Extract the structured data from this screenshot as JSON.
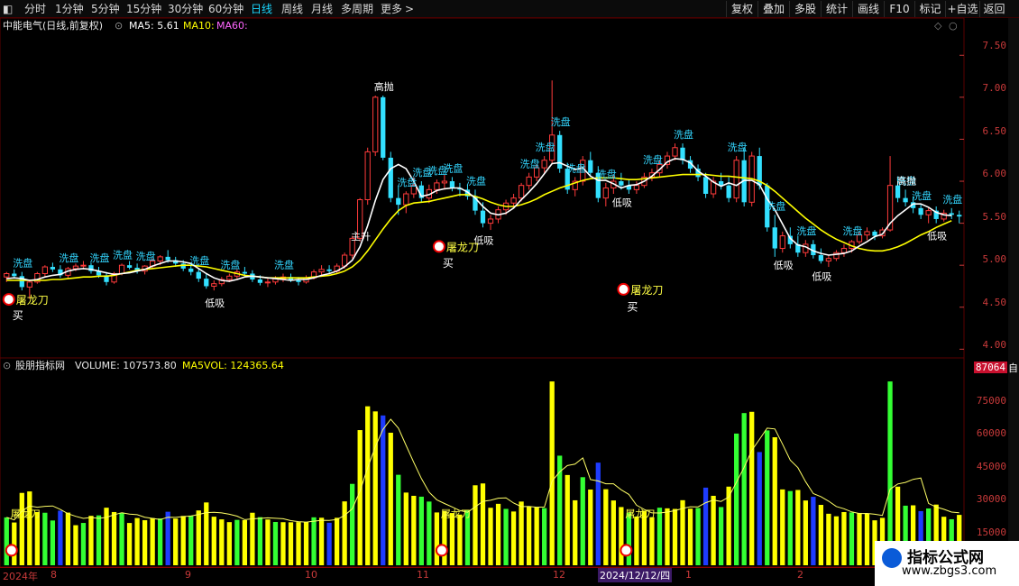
{
  "toolbar": {
    "periods": [
      "分时",
      "1分钟",
      "5分钟",
      "15分钟",
      "30分钟",
      "60分钟",
      "日线",
      "周线",
      "月线",
      "多周期",
      "更多"
    ],
    "active_period": "日线",
    "more_arrow": ">",
    "tools": [
      "复权",
      "叠加",
      "多股",
      "统计",
      "画线",
      "F10",
      "标记",
      "+自选",
      "返回"
    ]
  },
  "main_panel": {
    "stock_title": "中能电气(日线,前复权)",
    "ma_labels": [
      "MA5: 5.61",
      "MA10:",
      "MA60:"
    ],
    "price_axis": [
      "7.50",
      "7.00",
      "6.50",
      "6.00",
      "5.50",
      "5.00",
      "4.50",
      "4.00"
    ],
    "signals": {
      "wash": "洗盘",
      "low_buy": "低吸",
      "high_sell": "高抛",
      "main_rise": "主升",
      "dragon_knife": "屠龙刀",
      "buy": "买"
    }
  },
  "volume_panel": {
    "indicator_title": "股朋指标网",
    "volume_label": "VOLUME: 107573.80",
    "ma5vol_label": "MA5VOL: 124365.64",
    "current_value": "87064",
    "axis": [
      "75000",
      "60000",
      "45000",
      "30000",
      "15000"
    ]
  },
  "date_axis": [
    "2024年",
    "8",
    "9",
    "10",
    "11",
    "12",
    "2024/12/12/四",
    "1",
    "2"
  ],
  "right_strip": "自",
  "watermark": {
    "title": "指标公式网",
    "url": "www.zbgs3.com"
  },
  "colors": {
    "up": "#ff3b3b",
    "down": "#33e0ff",
    "ma_white": "#ffffff",
    "ma_yellow": "#ffff00",
    "axis": "#c93a3a"
  },
  "chart_data": {
    "type": "candlestick",
    "y_range": [
      3.95,
      7.75
    ],
    "candles_ohlc": [
      [
        4.86,
        4.92,
        4.8,
        4.9
      ],
      [
        4.9,
        4.95,
        4.85,
        4.87
      ],
      [
        4.87,
        4.92,
        4.7,
        4.74
      ],
      [
        4.74,
        4.82,
        4.6,
        4.8
      ],
      [
        4.8,
        4.92,
        4.78,
        4.9
      ],
      [
        4.9,
        5.0,
        4.86,
        4.98
      ],
      [
        4.98,
        5.03,
        4.92,
        4.95
      ],
      [
        4.95,
        5.0,
        4.85,
        4.88
      ],
      [
        4.88,
        4.98,
        4.84,
        4.96
      ],
      [
        4.96,
        5.02,
        4.93,
        4.99
      ],
      [
        4.99,
        5.05,
        4.95,
        5.0
      ],
      [
        5.0,
        5.03,
        4.9,
        4.93
      ],
      [
        4.93,
        4.98,
        4.85,
        4.88
      ],
      [
        4.88,
        4.92,
        4.76,
        4.8
      ],
      [
        4.8,
        4.92,
        4.78,
        4.9
      ],
      [
        4.9,
        5.02,
        4.88,
        5.0
      ],
      [
        5.0,
        5.05,
        4.95,
        4.97
      ],
      [
        4.97,
        5.02,
        4.9,
        4.93
      ],
      [
        4.93,
        5.0,
        4.89,
        4.99
      ],
      [
        4.99,
        5.08,
        4.96,
        5.05
      ],
      [
        5.05,
        5.12,
        5.0,
        5.1
      ],
      [
        5.1,
        5.18,
        5.03,
        5.06
      ],
      [
        5.06,
        5.1,
        4.98,
        5.02
      ],
      [
        5.02,
        5.06,
        4.93,
        4.96
      ],
      [
        4.96,
        5.01,
        4.88,
        4.92
      ],
      [
        4.92,
        4.95,
        4.8,
        4.84
      ],
      [
        4.84,
        4.9,
        4.72,
        4.75
      ],
      [
        4.75,
        4.82,
        4.7,
        4.78
      ],
      [
        4.78,
        4.86,
        4.75,
        4.83
      ],
      [
        4.83,
        4.9,
        4.8,
        4.87
      ],
      [
        4.87,
        4.95,
        4.84,
        4.92
      ],
      [
        4.92,
        4.98,
        4.87,
        4.9
      ],
      [
        4.9,
        4.94,
        4.8,
        4.83
      ],
      [
        4.83,
        4.88,
        4.76,
        4.79
      ],
      [
        4.79,
        4.85,
        4.74,
        4.8
      ],
      [
        4.8,
        4.87,
        4.77,
        4.84
      ],
      [
        4.84,
        4.9,
        4.8,
        4.86
      ],
      [
        4.86,
        4.9,
        4.8,
        4.82
      ],
      [
        4.82,
        4.86,
        4.76,
        4.8
      ],
      [
        4.8,
        4.88,
        4.78,
        4.85
      ],
      [
        4.85,
        4.95,
        4.83,
        4.92
      ],
      [
        4.92,
        5.0,
        4.88,
        4.95
      ],
      [
        4.95,
        5.0,
        4.9,
        4.93
      ],
      [
        4.93,
        5.02,
        4.9,
        4.99
      ],
      [
        4.99,
        5.15,
        4.96,
        5.12
      ],
      [
        5.12,
        5.35,
        5.08,
        5.32
      ],
      [
        5.32,
        5.8,
        5.28,
        5.78
      ],
      [
        5.78,
        6.4,
        5.72,
        6.35
      ],
      [
        6.35,
        7.02,
        6.3,
        7.0
      ],
      [
        7.0,
        7.02,
        6.25,
        6.28
      ],
      [
        6.28,
        6.35,
        5.75,
        5.8
      ],
      [
        5.8,
        5.95,
        5.6,
        5.72
      ],
      [
        5.72,
        5.88,
        5.62,
        5.85
      ],
      [
        5.85,
        6.05,
        5.8,
        5.95
      ],
      [
        5.95,
        6.0,
        5.75,
        5.8
      ],
      [
        5.8,
        5.96,
        5.74,
        5.9
      ],
      [
        5.9,
        6.02,
        5.85,
        5.98
      ],
      [
        5.98,
        6.08,
        5.9,
        6.0
      ],
      [
        6.0,
        6.05,
        5.88,
        5.92
      ],
      [
        5.92,
        5.98,
        5.82,
        5.9
      ],
      [
        5.9,
        5.96,
        5.78,
        5.82
      ],
      [
        5.82,
        5.9,
        5.6,
        5.65
      ],
      [
        5.65,
        5.75,
        5.45,
        5.5
      ],
      [
        5.5,
        5.6,
        5.42,
        5.55
      ],
      [
        5.55,
        5.7,
        5.5,
        5.66
      ],
      [
        5.66,
        5.78,
        5.6,
        5.74
      ],
      [
        5.74,
        5.85,
        5.68,
        5.8
      ],
      [
        5.8,
        5.98,
        5.76,
        5.95
      ],
      [
        5.95,
        6.1,
        5.9,
        6.05
      ],
      [
        6.05,
        6.2,
        6.0,
        6.16
      ],
      [
        6.16,
        6.3,
        6.1,
        6.25
      ],
      [
        6.25,
        7.2,
        6.2,
        6.55
      ],
      [
        6.55,
        6.6,
        6.1,
        6.15
      ],
      [
        6.15,
        6.22,
        5.85,
        5.9
      ],
      [
        5.9,
        6.05,
        5.82,
        6.0
      ],
      [
        6.0,
        6.3,
        5.95,
        6.25
      ],
      [
        6.25,
        6.35,
        6.05,
        6.1
      ],
      [
        6.1,
        6.18,
        5.75,
        5.8
      ],
      [
        5.8,
        5.98,
        5.7,
        5.92
      ],
      [
        5.92,
        6.08,
        5.85,
        6.0
      ],
      [
        6.0,
        6.1,
        5.9,
        5.95
      ],
      [
        5.95,
        6.02,
        5.85,
        5.9
      ],
      [
        5.9,
        6.0,
        5.85,
        5.95
      ],
      [
        5.95,
        6.1,
        5.92,
        6.05
      ],
      [
        6.05,
        6.15,
        6.0,
        6.1
      ],
      [
        6.1,
        6.25,
        6.05,
        6.2
      ],
      [
        6.2,
        6.35,
        6.15,
        6.3
      ],
      [
        6.3,
        6.45,
        6.25,
        6.4
      ],
      [
        6.4,
        6.45,
        6.2,
        6.25
      ],
      [
        6.25,
        6.3,
        6.1,
        6.15
      ],
      [
        6.15,
        6.2,
        6.0,
        6.05
      ],
      [
        6.05,
        6.1,
        5.8,
        5.85
      ],
      [
        5.85,
        6.05,
        5.8,
        6.0
      ],
      [
        6.0,
        6.1,
        5.9,
        5.95
      ],
      [
        5.95,
        6.05,
        5.75,
        5.8
      ],
      [
        5.8,
        6.3,
        5.75,
        6.25
      ],
      [
        6.25,
        6.4,
        5.7,
        5.75
      ],
      [
        5.75,
        6.35,
        5.7,
        6.3
      ],
      [
        6.3,
        6.4,
        5.9,
        5.95
      ],
      [
        5.95,
        5.98,
        5.4,
        5.45
      ],
      [
        5.45,
        5.6,
        5.1,
        5.2
      ],
      [
        5.2,
        5.4,
        5.15,
        5.35
      ],
      [
        5.35,
        5.45,
        5.2,
        5.25
      ],
      [
        5.25,
        5.35,
        5.1,
        5.15
      ],
      [
        5.15,
        5.3,
        5.1,
        5.25
      ],
      [
        5.25,
        5.3,
        5.08,
        5.12
      ],
      [
        5.12,
        5.2,
        5.02,
        5.05
      ],
      [
        5.05,
        5.12,
        4.98,
        5.08
      ],
      [
        5.08,
        5.18,
        5.05,
        5.15
      ],
      [
        5.15,
        5.25,
        5.1,
        5.2
      ],
      [
        5.2,
        5.3,
        5.15,
        5.28
      ],
      [
        5.28,
        5.4,
        5.25,
        5.36
      ],
      [
        5.36,
        5.45,
        5.3,
        5.4
      ],
      [
        5.4,
        5.42,
        5.3,
        5.35
      ],
      [
        5.35,
        5.45,
        5.32,
        5.42
      ],
      [
        5.42,
        6.3,
        5.4,
        5.95
      ],
      [
        5.95,
        6.05,
        5.75,
        5.8
      ],
      [
        5.8,
        5.9,
        5.7,
        5.75
      ],
      [
        5.75,
        5.82,
        5.62,
        5.68
      ],
      [
        5.68,
        5.72,
        5.55,
        5.6
      ],
      [
        5.6,
        5.68,
        5.5,
        5.65
      ],
      [
        5.65,
        5.7,
        5.5,
        5.55
      ],
      [
        5.55,
        5.66,
        5.52,
        5.62
      ],
      [
        5.62,
        5.68,
        5.55,
        5.6
      ],
      [
        5.6,
        5.65,
        5.5,
        5.58
      ]
    ],
    "ma5": [
      4.84,
      4.85,
      4.84,
      4.82,
      4.83,
      4.86,
      4.88,
      4.89,
      4.93,
      4.95,
      4.96,
      4.95,
      4.93,
      4.91,
      4.89,
      4.9,
      4.91,
      4.93,
      4.95,
      4.99,
      5.02,
      5.05,
      5.05,
      5.04,
      5.02,
      4.96,
      4.9,
      4.85,
      4.82,
      4.81,
      4.83,
      4.86,
      4.87,
      4.86,
      4.85,
      4.84,
      4.83,
      4.82,
      4.83,
      4.83,
      4.85,
      4.88,
      4.9,
      4.93,
      4.98,
      5.06,
      5.22,
      5.47,
      5.77,
      6.02,
      6.15,
      6.2,
      6.15,
      6.0,
      5.82,
      5.84,
      5.89,
      5.91,
      5.92,
      5.92,
      5.87,
      5.8,
      5.7,
      5.62,
      5.6,
      5.62,
      5.68,
      5.78,
      5.87,
      5.97,
      6.09,
      6.21,
      6.22,
      6.18,
      6.14,
      6.16,
      6.06,
      6.01,
      6.01,
      5.97,
      5.92,
      5.95,
      5.96,
      6.0,
      6.06,
      6.14,
      6.23,
      6.27,
      6.26,
      6.22,
      6.12,
      6.06,
      5.99,
      5.94,
      5.98,
      5.95,
      6.01,
      6.01,
      5.96,
      5.79,
      5.66,
      5.49,
      5.32,
      5.24,
      5.22,
      5.17,
      5.14,
      5.12,
      5.13,
      5.14,
      5.17,
      5.23,
      5.28,
      5.34,
      5.37,
      5.5,
      5.59,
      5.66,
      5.73,
      5.73,
      5.69,
      5.63,
      5.6,
      5.59
    ],
    "ma10": [
      4.82,
      4.82,
      4.82,
      4.82,
      4.82,
      4.82,
      4.83,
      4.83,
      4.84,
      4.85,
      4.86,
      4.86,
      4.87,
      4.87,
      4.88,
      4.9,
      4.92,
      4.94,
      4.95,
      4.96,
      4.97,
      4.98,
      4.99,
      5.0,
      5.0,
      4.99,
      4.98,
      4.96,
      4.94,
      4.92,
      4.9,
      4.88,
      4.87,
      4.86,
      4.85,
      4.85,
      4.85,
      4.85,
      4.85,
      4.85,
      4.86,
      4.87,
      4.88,
      4.9,
      4.93,
      4.98,
      5.06,
      5.17,
      5.3,
      5.43,
      5.55,
      5.65,
      5.71,
      5.74,
      5.75,
      5.76,
      5.78,
      5.8,
      5.82,
      5.84,
      5.84,
      5.82,
      5.79,
      5.75,
      5.72,
      5.7,
      5.7,
      5.72,
      5.75,
      5.79,
      5.84,
      5.88,
      5.92,
      5.95,
      5.98,
      6.01,
      6.03,
      6.04,
      6.04,
      6.04,
      6.03,
      6.02,
      6.02,
      6.03,
      6.04,
      6.05,
      6.06,
      6.07,
      6.08,
      6.08,
      6.08,
      6.08,
      6.07,
      6.06,
      6.06,
      6.05,
      6.04,
      6.03,
      6.0,
      5.95,
      5.88,
      5.8,
      5.72,
      5.64,
      5.56,
      5.49,
      5.42,
      5.36,
      5.31,
      5.27,
      5.23,
      5.2,
      5.18,
      5.17,
      5.17,
      5.19,
      5.22,
      5.26,
      5.31,
      5.36,
      5.4,
      5.45,
      5.49,
      5.53
    ]
  }
}
